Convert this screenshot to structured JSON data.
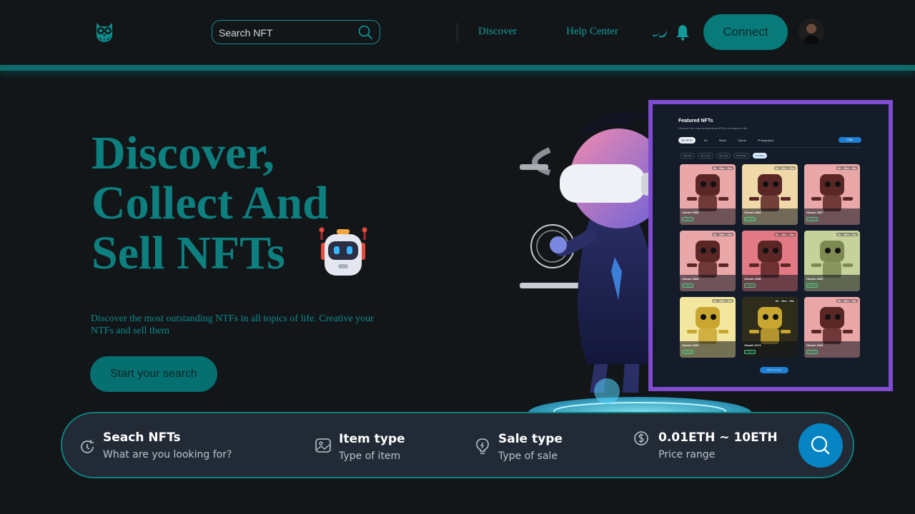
{
  "header": {
    "search_placeholder": "Search NFT",
    "nav": [
      "Discover",
      "Help Center"
    ],
    "connect_label": "Connect"
  },
  "hero": {
    "title_lines": [
      "Discover,",
      "Collect And",
      "Sell NFTs"
    ],
    "description": "Discover the most outstanding NTFs in all topics of life. Creative your NTFs and sell them",
    "cta_label": "Start your search"
  },
  "embedded_screenshot": {
    "title": "Featured NFTs",
    "subtitle": "Discover the most outstanding NFTs in all topics of life.",
    "tabs": [
      "3D NFTs",
      "Art",
      "Music",
      "Sports",
      "Photography"
    ],
    "filter_label": "Filter",
    "chips": [
      "Collection",
      "Sort: price",
      "Sale type",
      "Blockchain",
      "Trending"
    ],
    "cards": [
      {
        "name": "Clone# #305",
        "timer": "3h : 15m : 20s",
        "price": "1.00ETH",
        "bg": "#e9a7a8"
      },
      {
        "name": "Clone# #384",
        "timer": "3h : 15m : 20s",
        "price": "1.00ETH",
        "bg": "#efd9a8"
      },
      {
        "name": "Clone# #067",
        "timer": "3h : 15m : 20s",
        "price": "1.00ETH",
        "bg": "#e9a7a8"
      },
      {
        "name": "Clone# #303",
        "timer": "3h : 15m : 20s",
        "price": "1.00ETH",
        "bg": "#e9a7a8"
      },
      {
        "name": "Clone# #108",
        "timer": "3h : 15m : 20s",
        "price": "1.00ETH",
        "bg": "#e27a85"
      },
      {
        "name": "Clone# #322",
        "timer": "3h : 15m : 20s",
        "price": "1.00ETH",
        "bg": "#c7d19c"
      },
      {
        "name": "Clone# #326",
        "timer": "3h : 15m : 20s",
        "price": "1.00ETH",
        "bg": "#f3e7a0"
      },
      {
        "name": "Clone# #174",
        "timer": "3h : 15m : 20s",
        "price": "1.00ETH",
        "bg": "#2e2d1c"
      },
      {
        "name": "Clone# #344",
        "timer": "3h : 15m : 20s",
        "price": "1.00ETH",
        "bg": "#e9a7a8"
      }
    ],
    "more_label": "Show me more"
  },
  "searchbar": {
    "items": [
      {
        "title": "Seach NFTs",
        "subtitle": "What are you looking for?",
        "icon": "refresh-search-icon"
      },
      {
        "title": "Item type",
        "subtitle": "Type of item",
        "icon": "image-icon"
      },
      {
        "title": "Sale type",
        "subtitle": "Type of sale",
        "icon": "lightbulb-icon"
      },
      {
        "title": "0.01ETH ~ 10ETH",
        "subtitle": "Price range",
        "icon": "dollar-coin-icon"
      }
    ]
  },
  "colors": {
    "background": "#121619",
    "teal": "#0e7f7f",
    "connect": "#087a7a",
    "embed_border": "#7f4bd1",
    "search_go": "#0784c4",
    "searchbar_bg": "#222a36"
  }
}
